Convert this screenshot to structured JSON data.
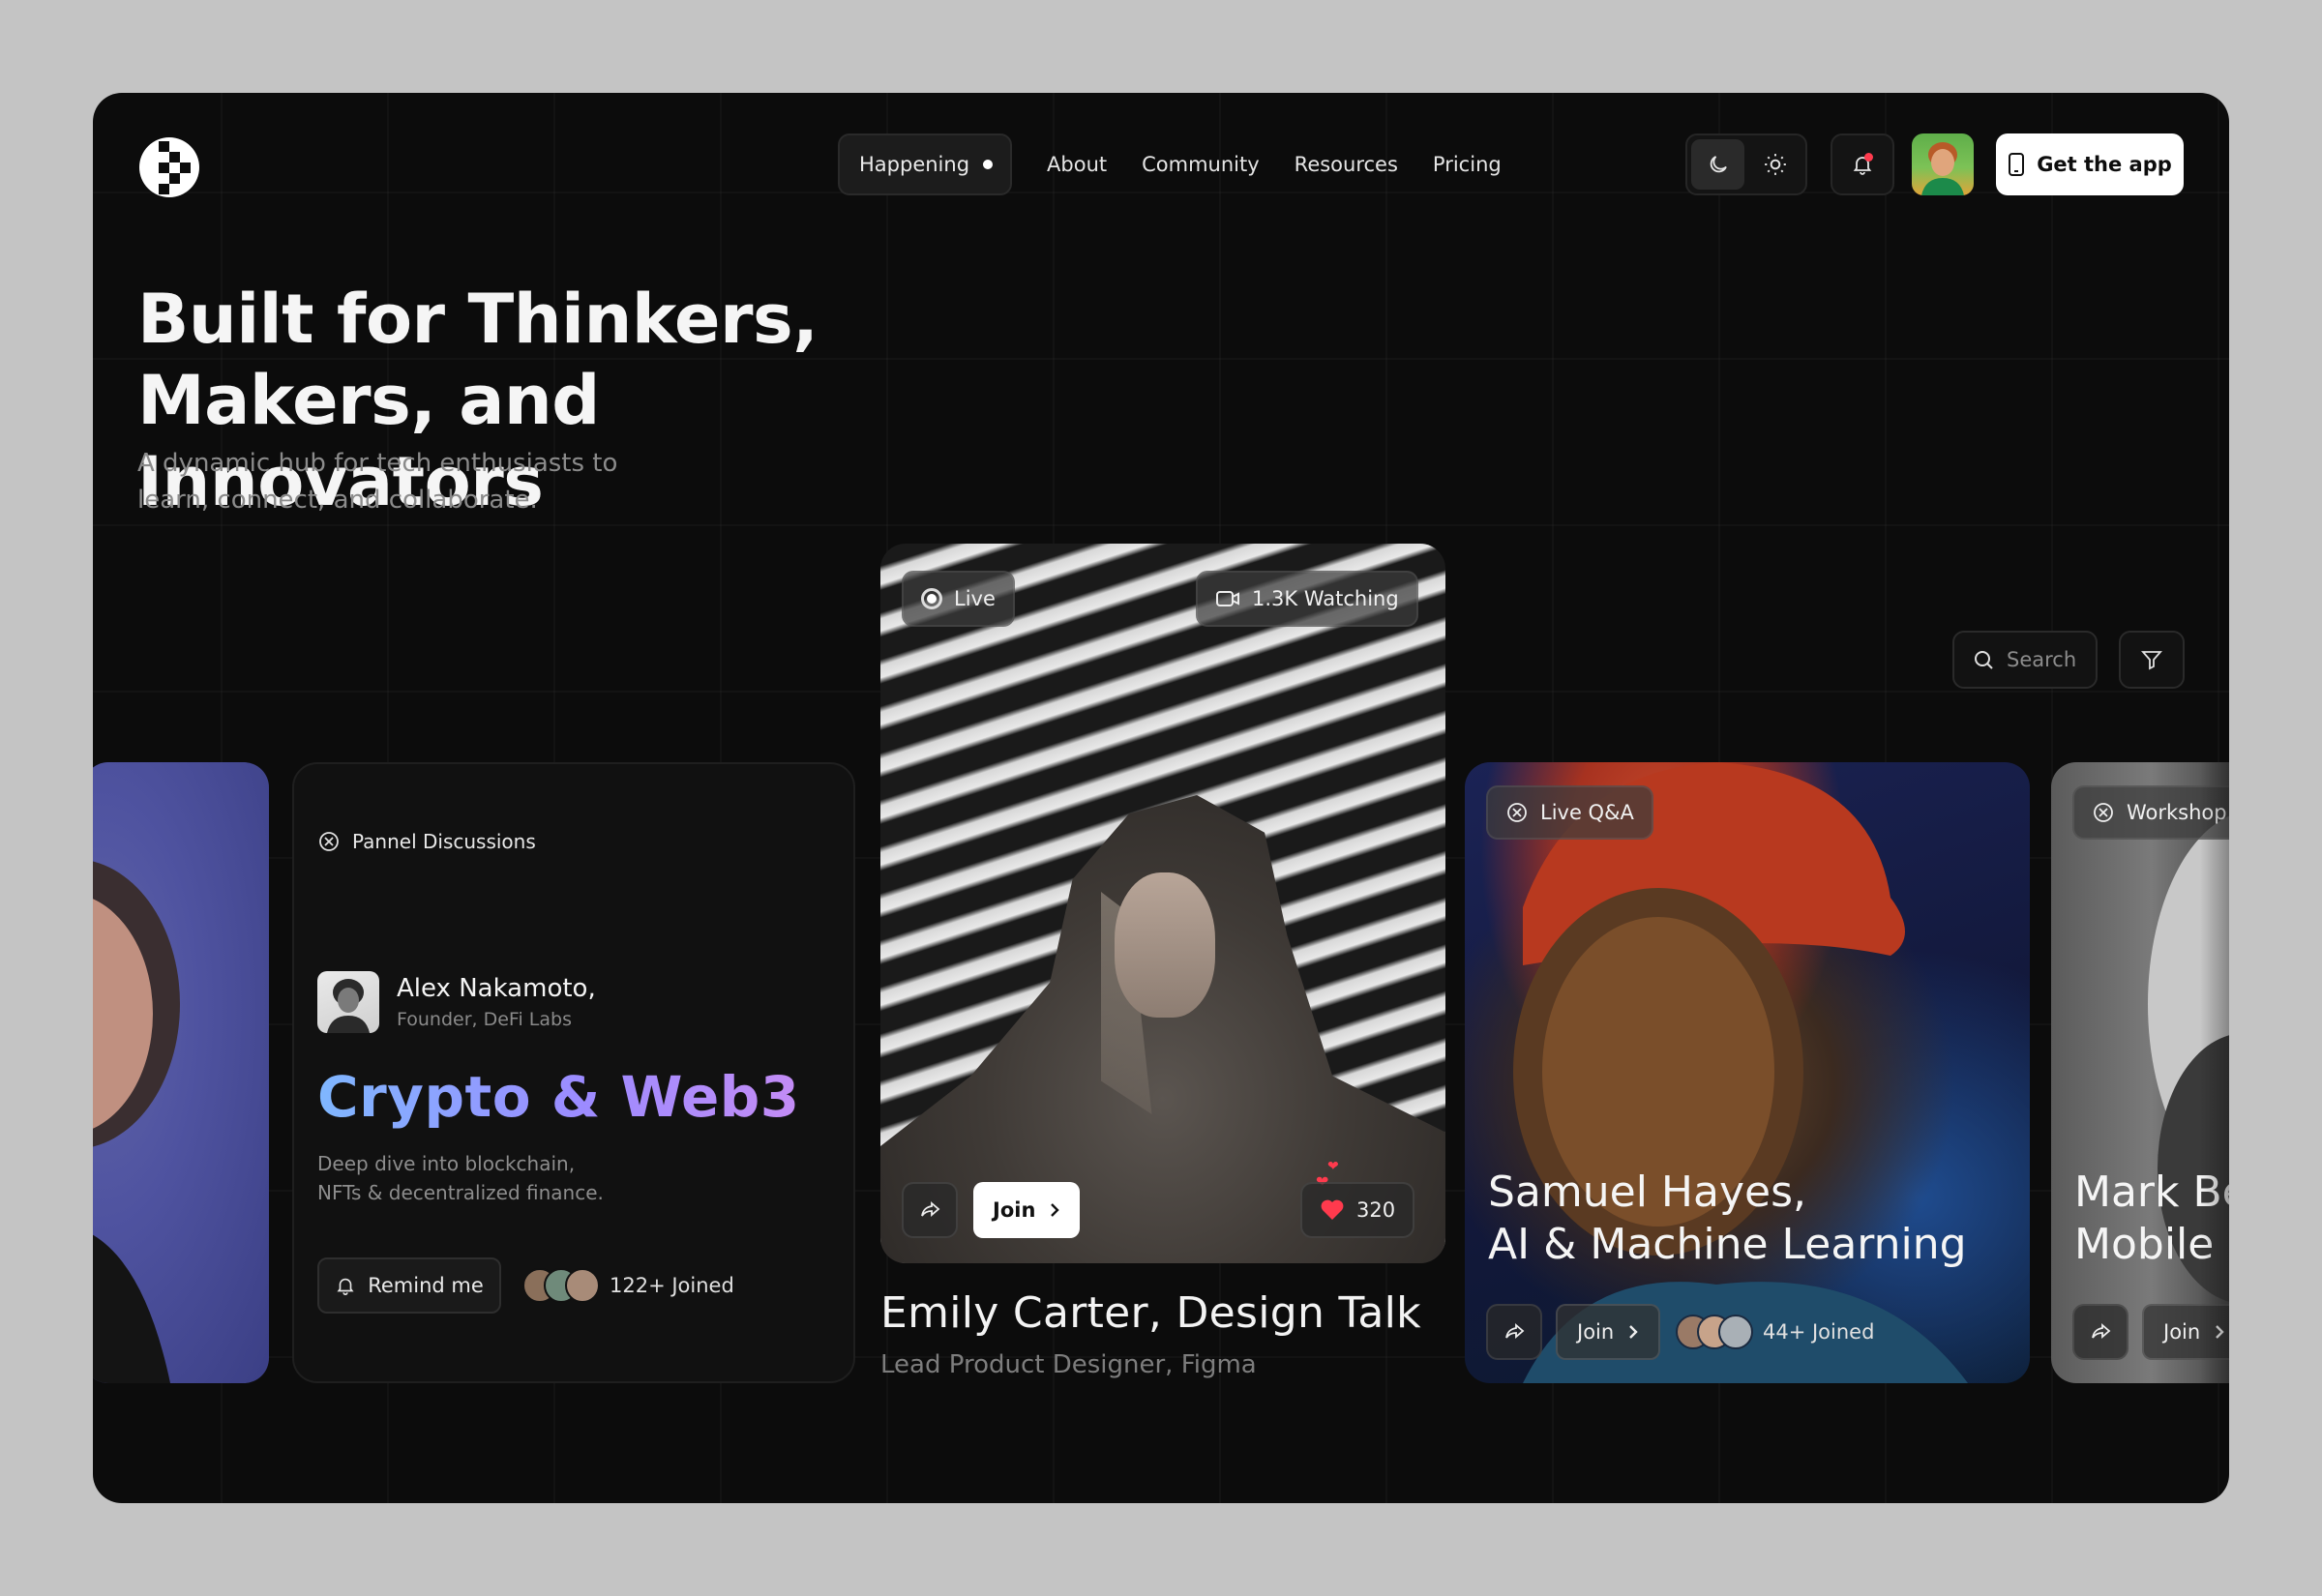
{
  "nav": {
    "active": "Happening",
    "links": [
      "About",
      "Community",
      "Resources",
      "Pricing"
    ],
    "get_app": "Get the app"
  },
  "hero": {
    "title_line1": "Built for Thinkers,",
    "title_line2": "Makers, and Innovators",
    "subtitle_line1": "A dynamic hub for tech enthusiasts to",
    "subtitle_line2": "learn, connect, and collaborate."
  },
  "search": {
    "placeholder": "Search"
  },
  "cards": {
    "panel": {
      "tag": "Pannel Discussions",
      "speaker_name": "Alex Nakamoto,",
      "speaker_role": "Founder, DeFi Labs",
      "title": "Crypto & Web3",
      "desc_line1": "Deep dive into blockchain,",
      "desc_line2": "NFTs & decentralized finance.",
      "remind": "Remind me",
      "joined": "122+ Joined"
    },
    "main": {
      "live": "Live",
      "watching": "1.3K Watching",
      "join": "Join",
      "likes": "320",
      "caption": "Emily Carter, Design Talk",
      "role": "Lead Product Designer, Figma"
    },
    "samuel": {
      "tag": "Live Q&A",
      "name_line1": "Samuel Hayes,",
      "name_line2": "AI & Machine Learning",
      "join": "Join",
      "joined": "44+ Joined"
    },
    "mark": {
      "tag": "Workshop",
      "name_line1": "Mark Be",
      "name_line2": "Mobile",
      "join": "Join"
    }
  },
  "colors": {
    "background": "#0c0c0c",
    "accent_gradient_start": "#7fb7ff",
    "accent_gradient_end": "#c48cf5",
    "notification": "#ff3b4e",
    "like": "#ff3a4d"
  },
  "icons": [
    "logo-icon",
    "moon-icon",
    "sun-icon",
    "bell-icon",
    "phone-icon",
    "search-icon",
    "filter-icon",
    "workshop-icon",
    "share-icon",
    "video-icon",
    "heart-icon",
    "chevron-right-icon"
  ]
}
